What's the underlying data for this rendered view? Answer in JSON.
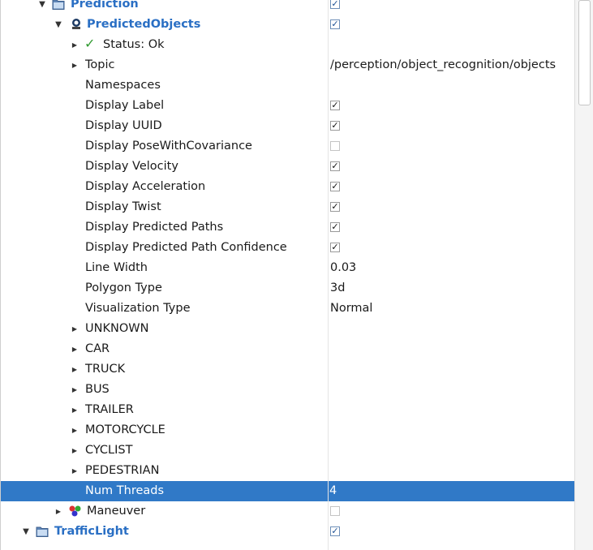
{
  "rows": {
    "prediction": {
      "label": "Prediction",
      "checked": "✓"
    },
    "predicted_objects": {
      "label": "PredictedObjects",
      "checked": "✓"
    },
    "status": {
      "label": "Status: Ok"
    },
    "topic": {
      "label": "Topic",
      "value": "/perception/object_recognition/objects"
    },
    "namespaces": {
      "label": "Namespaces"
    },
    "display_label": {
      "label": "Display Label",
      "checked": "✓"
    },
    "display_uuid": {
      "label": "Display UUID",
      "checked": "✓"
    },
    "display_pose": {
      "label": "Display PoseWithCovariance",
      "checked": ""
    },
    "display_velocity": {
      "label": "Display Velocity",
      "checked": "✓"
    },
    "display_acceleration": {
      "label": "Display Acceleration",
      "checked": "✓"
    },
    "display_twist": {
      "label": "Display Twist",
      "checked": "✓"
    },
    "display_paths": {
      "label": "Display Predicted Paths",
      "checked": "✓"
    },
    "display_path_conf": {
      "label": "Display Predicted Path Confidence",
      "checked": "✓"
    },
    "line_width": {
      "label": "Line Width",
      "value": "0.03"
    },
    "polygon_type": {
      "label": "Polygon Type",
      "value": "3d"
    },
    "vis_type": {
      "label": "Visualization Type",
      "value": "Normal"
    },
    "classes": [
      "UNKNOWN",
      "CAR",
      "TRUCK",
      "BUS",
      "TRAILER",
      "MOTORCYCLE",
      "CYCLIST",
      "PEDESTRIAN"
    ],
    "num_threads": {
      "label": "Num Threads",
      "value": "4"
    },
    "maneuver": {
      "label": "Maneuver",
      "checked": ""
    },
    "traffic_light": {
      "label": "TrafficLight",
      "checked": "✓"
    }
  },
  "icons": {
    "folder": "folder-icon",
    "robot": "predicted-objects-display-icon",
    "status_ok": "checkmark-icon",
    "maneuver": "marker-display-icon"
  },
  "colors": {
    "selection": "#3079c7",
    "group_label": "#2a6fc4",
    "ok_check": "#2f9a2f"
  }
}
